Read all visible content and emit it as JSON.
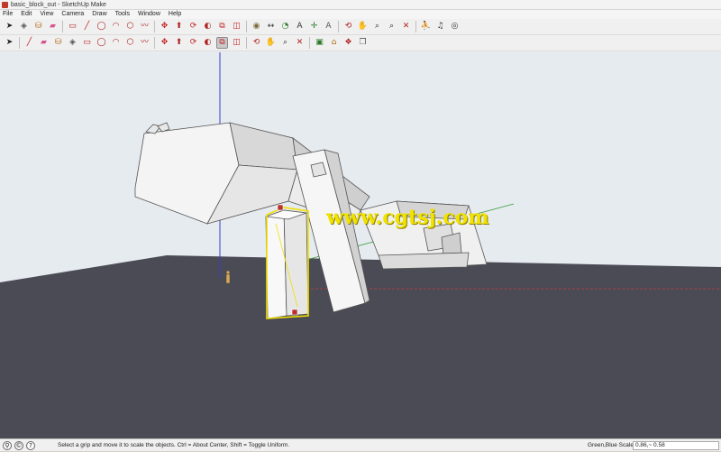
{
  "window": {
    "title": "basic_block_out - SketchUp Make"
  },
  "menu": [
    "File",
    "Edit",
    "View",
    "Camera",
    "Draw",
    "Tools",
    "Window",
    "Help"
  ],
  "toolbar1": [
    {
      "name": "select-icon",
      "glyph": "➤",
      "color": "#222222"
    },
    {
      "name": "make-component-icon",
      "glyph": "◈",
      "color": "#555555"
    },
    {
      "name": "paint-bucket-icon",
      "glyph": "⛁",
      "color": "#b06a1c"
    },
    {
      "name": "eraser-icon",
      "glyph": "▰",
      "color": "#d8548c"
    },
    {
      "name": "sep"
    },
    {
      "name": "rectangle-icon",
      "glyph": "▭",
      "color": "#b02020"
    },
    {
      "name": "line-icon",
      "glyph": "╱",
      "color": "#c02020"
    },
    {
      "name": "circle-icon",
      "glyph": "◯",
      "color": "#b02020"
    },
    {
      "name": "arc-icon",
      "glyph": "◠",
      "color": "#b02020"
    },
    {
      "name": "polygon-icon",
      "glyph": "⬡",
      "color": "#b02020"
    },
    {
      "name": "freehand-icon",
      "glyph": "〰",
      "color": "#b02020"
    },
    {
      "name": "sep"
    },
    {
      "name": "move-icon",
      "glyph": "✥",
      "color": "#c02020"
    },
    {
      "name": "push-pull-icon",
      "glyph": "⬆",
      "color": "#b02020"
    },
    {
      "name": "rotate-icon",
      "glyph": "⟳",
      "color": "#c02020"
    },
    {
      "name": "follow-me-icon",
      "glyph": "◐",
      "color": "#b02020"
    },
    {
      "name": "scale-icon",
      "glyph": "⧉",
      "color": "#c02020"
    },
    {
      "name": "offset-icon",
      "glyph": "◫",
      "color": "#c02020"
    },
    {
      "name": "sep"
    },
    {
      "name": "tape-measure-icon",
      "glyph": "◉",
      "color": "#7a6a3a"
    },
    {
      "name": "dimension-icon",
      "glyph": "↔",
      "color": "#333333"
    },
    {
      "name": "protractor-icon",
      "glyph": "◔",
      "color": "#2a7a2a"
    },
    {
      "name": "text-icon",
      "glyph": "A",
      "color": "#333333"
    },
    {
      "name": "axes-icon",
      "glyph": "✛",
      "color": "#2a7a2a"
    },
    {
      "name": "3d-text-icon",
      "glyph": "A",
      "color": "#555555"
    },
    {
      "name": "sep"
    },
    {
      "name": "orbit-icon",
      "glyph": "⟲",
      "color": "#b02020"
    },
    {
      "name": "pan-icon",
      "glyph": "✋",
      "color": "#555555"
    },
    {
      "name": "zoom-icon",
      "glyph": "⌕",
      "color": "#333333"
    },
    {
      "name": "zoom-window-icon",
      "glyph": "⌕",
      "color": "#333333"
    },
    {
      "name": "zoom-extents-icon",
      "glyph": "✕",
      "color": "#b02020"
    },
    {
      "name": "sep"
    },
    {
      "name": "position-camera-icon",
      "glyph": "⛹",
      "color": "#333333"
    },
    {
      "name": "walk-icon",
      "glyph": "♫",
      "color": "#333333"
    },
    {
      "name": "look-around-icon",
      "glyph": "◎",
      "color": "#333333"
    }
  ],
  "toolbar2": [
    {
      "name": "select-icon",
      "glyph": "➤",
      "color": "#222222"
    },
    {
      "name": "sep"
    },
    {
      "name": "line-icon",
      "glyph": "╱",
      "color": "#c02020"
    },
    {
      "name": "eraser-icon",
      "glyph": "▰",
      "color": "#d8548c"
    },
    {
      "name": "paint-bucket-icon",
      "glyph": "⛁",
      "color": "#b06a1c"
    },
    {
      "name": "make-component-icon",
      "glyph": "◈",
      "color": "#555555"
    },
    {
      "name": "rectangle-icon",
      "glyph": "▭",
      "color": "#b02020"
    },
    {
      "name": "circle-icon",
      "glyph": "◯",
      "color": "#b02020"
    },
    {
      "name": "arc-icon",
      "glyph": "◠",
      "color": "#b02020"
    },
    {
      "name": "polygon-icon",
      "glyph": "⬡",
      "color": "#b02020"
    },
    {
      "name": "freehand-icon",
      "glyph": "〰",
      "color": "#b02020"
    },
    {
      "name": "sep"
    },
    {
      "name": "move-icon",
      "glyph": "✥",
      "color": "#c02020"
    },
    {
      "name": "push-pull-icon",
      "glyph": "⬆",
      "color": "#b02020"
    },
    {
      "name": "rotate-icon",
      "glyph": "⟳",
      "color": "#c02020"
    },
    {
      "name": "follow-me-icon",
      "glyph": "◐",
      "color": "#b02020"
    },
    {
      "name": "scale-icon",
      "glyph": "⧉",
      "color": "#c02020",
      "active": true
    },
    {
      "name": "offset-icon",
      "glyph": "◫",
      "color": "#c02020"
    },
    {
      "name": "sep"
    },
    {
      "name": "orbit-icon",
      "glyph": "⟲",
      "color": "#b02020"
    },
    {
      "name": "pan-icon",
      "glyph": "✋",
      "color": "#555555"
    },
    {
      "name": "zoom-icon",
      "glyph": "⌕",
      "color": "#333333"
    },
    {
      "name": "zoom-extents-icon",
      "glyph": "✕",
      "color": "#b02020"
    },
    {
      "name": "sep"
    },
    {
      "name": "components-icon",
      "glyph": "▣",
      "color": "#2a7a2a"
    },
    {
      "name": "warehouse-icon",
      "glyph": "⌂",
      "color": "#b06a1c"
    },
    {
      "name": "share-model-icon",
      "glyph": "❖",
      "color": "#b02020"
    },
    {
      "name": "extension-warehouse-icon",
      "glyph": "❐",
      "color": "#555555"
    }
  ],
  "watermark": "www.cgtsj.com",
  "status": {
    "message": "Select a grip and move it to scale the objects. Ctrl = About Center, Shift = Toggle Uniform.",
    "vcb_label": "Green,Blue Scale",
    "vcb_value": "0.86,~ 0.58",
    "icons": [
      {
        "name": "geo-location-icon",
        "glyph": "⚲"
      },
      {
        "name": "credits-icon",
        "glyph": "©"
      },
      {
        "name": "help-icon",
        "glyph": "?"
      }
    ]
  },
  "colors": {
    "sky": "#e6ebf0",
    "ground": "#4b4b55",
    "selection": "#f0e000",
    "axis_blue": "#3c3cc8",
    "axis_red": "#c83c3c",
    "axis_green": "#3c9c3c"
  }
}
